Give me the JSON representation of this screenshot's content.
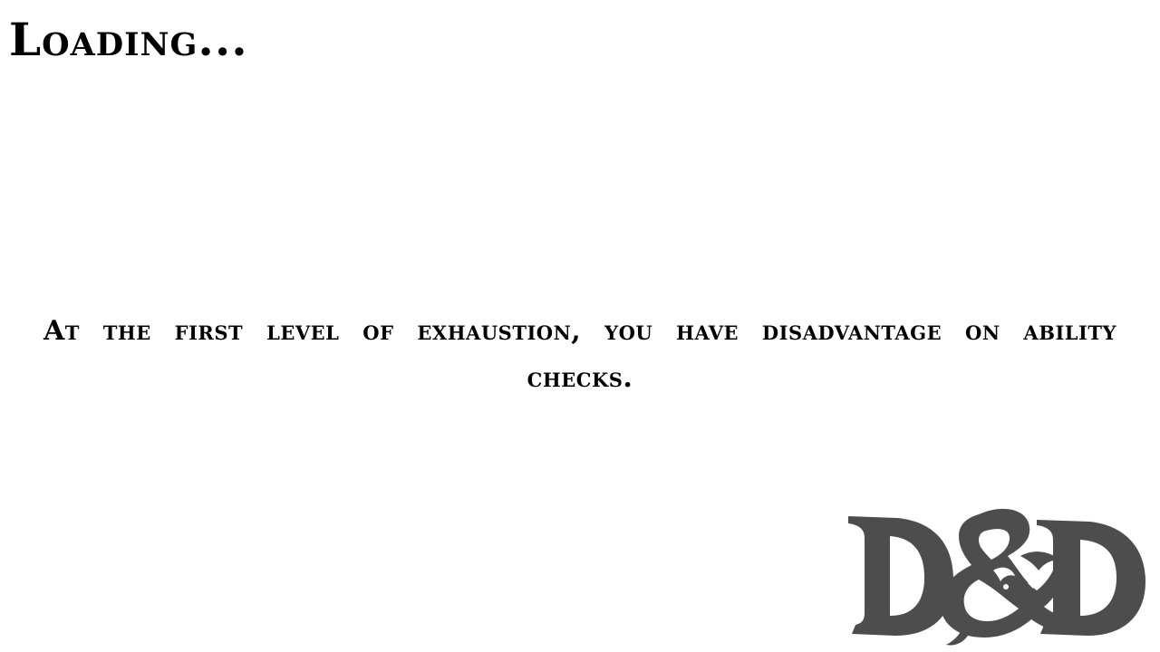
{
  "loading": {
    "title": "Loading..."
  },
  "tip": {
    "text": "At the first level of exhaustion, you have disadvantage on ability checks."
  },
  "logo": {
    "icon": "dungeons-and-dragons-ampersand-logo",
    "color": "#4d4d4d"
  }
}
